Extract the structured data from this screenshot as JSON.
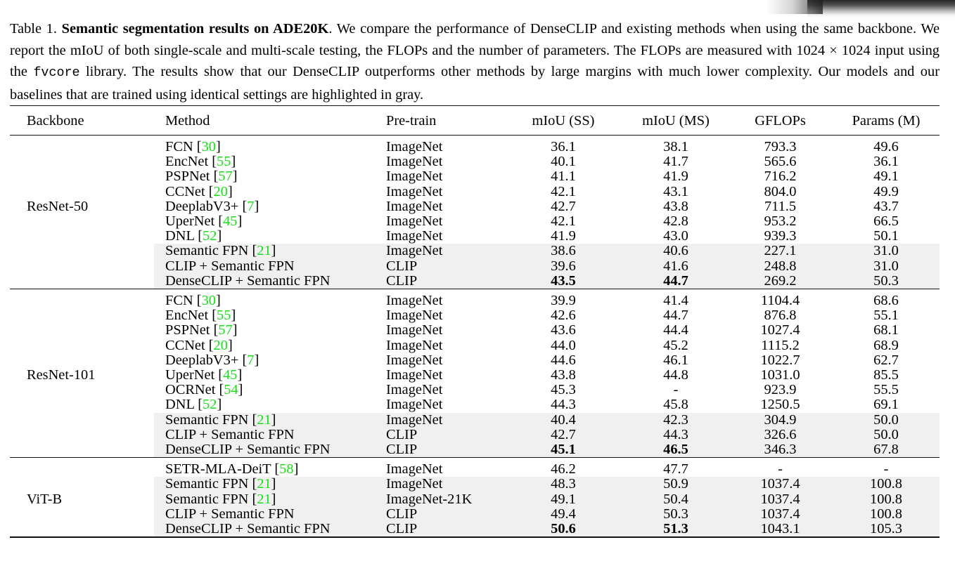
{
  "caption": {
    "label": "Table 1.",
    "title": "Semantic segmentation results on ADE20K",
    "body_1": ". We compare the performance of DenseCLIP and existing methods when using the same backbone. We report the mIoU of both single-scale and multi-scale testing, the FLOPs and the number of parameters. The FLOPs are measured with 1024 × 1024 input using the ",
    "library": "fvcore",
    "body_2": " library. The results show that our DenseCLIP outperforms other methods by large margins with much lower complexity. Our models and our baselines that are trained using identical settings are highlighted in gray."
  },
  "colors": {
    "citation_green": "#15e015",
    "highlight_gray": "#f0f0f0",
    "rule_black": "#111111"
  },
  "table": {
    "headers": [
      "Backbone",
      "Method",
      "Pre-train",
      "mIoU (SS)",
      "mIoU (MS)",
      "GFLOPs",
      "Params (M)"
    ],
    "blocks": [
      {
        "backbone": "ResNet-50",
        "rows": [
          {
            "method": "FCN",
            "cite": "30",
            "pretrain": "ImageNet",
            "ss": "36.1",
            "ms": "38.1",
            "gflops": "793.3",
            "params": "49.6",
            "highlight": false,
            "bold_ss": false,
            "bold_ms": false
          },
          {
            "method": "EncNet",
            "cite": "55",
            "pretrain": "ImageNet",
            "ss": "40.1",
            "ms": "41.7",
            "gflops": "565.6",
            "params": "36.1",
            "highlight": false,
            "bold_ss": false,
            "bold_ms": false
          },
          {
            "method": "PSPNet",
            "cite": "57",
            "pretrain": "ImageNet",
            "ss": "41.1",
            "ms": "41.9",
            "gflops": "716.2",
            "params": "49.1",
            "highlight": false,
            "bold_ss": false,
            "bold_ms": false
          },
          {
            "method": "CCNet",
            "cite": "20",
            "pretrain": "ImageNet",
            "ss": "42.1",
            "ms": "43.1",
            "gflops": "804.0",
            "params": "49.9",
            "highlight": false,
            "bold_ss": false,
            "bold_ms": false
          },
          {
            "method": "DeeplabV3+",
            "cite": "7",
            "pretrain": "ImageNet",
            "ss": "42.7",
            "ms": "43.8",
            "gflops": "711.5",
            "params": "43.7",
            "highlight": false,
            "bold_ss": false,
            "bold_ms": false
          },
          {
            "method": "UperNet",
            "cite": "45",
            "pretrain": "ImageNet",
            "ss": "42.1",
            "ms": "42.8",
            "gflops": "953.2",
            "params": "66.5",
            "highlight": false,
            "bold_ss": false,
            "bold_ms": false
          },
          {
            "method": "DNL",
            "cite": "52",
            "pretrain": "ImageNet",
            "ss": "41.9",
            "ms": "43.0",
            "gflops": "939.3",
            "params": "50.1",
            "highlight": false,
            "bold_ss": false,
            "bold_ms": false
          },
          {
            "method": "Semantic FPN",
            "cite": "21",
            "pretrain": "ImageNet",
            "ss": "38.6",
            "ms": "40.6",
            "gflops": "227.1",
            "params": "31.0",
            "highlight": true,
            "bold_ss": false,
            "bold_ms": false
          },
          {
            "method": "CLIP + Semantic FPN",
            "cite": null,
            "pretrain": "CLIP",
            "ss": "39.6",
            "ms": "41.6",
            "gflops": "248.8",
            "params": "31.0",
            "highlight": true,
            "bold_ss": false,
            "bold_ms": false
          },
          {
            "method": "DenseCLIP + Semantic FPN",
            "cite": null,
            "pretrain": "CLIP",
            "ss": "43.5",
            "ms": "44.7",
            "gflops": "269.2",
            "params": "50.3",
            "highlight": true,
            "bold_ss": true,
            "bold_ms": true
          }
        ]
      },
      {
        "backbone": "ResNet-101",
        "rows": [
          {
            "method": "FCN",
            "cite": "30",
            "pretrain": "ImageNet",
            "ss": "39.9",
            "ms": "41.4",
            "gflops": "1104.4",
            "params": "68.6",
            "highlight": false,
            "bold_ss": false,
            "bold_ms": false
          },
          {
            "method": "EncNet",
            "cite": "55",
            "pretrain": "ImageNet",
            "ss": "42.6",
            "ms": "44.7",
            "gflops": "876.8",
            "params": "55.1",
            "highlight": false,
            "bold_ss": false,
            "bold_ms": false
          },
          {
            "method": "PSPNet",
            "cite": "57",
            "pretrain": "ImageNet",
            "ss": "43.6",
            "ms": "44.4",
            "gflops": "1027.4",
            "params": "68.1",
            "highlight": false,
            "bold_ss": false,
            "bold_ms": false
          },
          {
            "method": "CCNet",
            "cite": "20",
            "pretrain": "ImageNet",
            "ss": "44.0",
            "ms": "45.2",
            "gflops": "1115.2",
            "params": "68.9",
            "highlight": false,
            "bold_ss": false,
            "bold_ms": false
          },
          {
            "method": "DeeplabV3+",
            "cite": "7",
            "pretrain": "ImageNet",
            "ss": "44.6",
            "ms": "46.1",
            "gflops": "1022.7",
            "params": "62.7",
            "highlight": false,
            "bold_ss": false,
            "bold_ms": false
          },
          {
            "method": "UperNet",
            "cite": "45",
            "pretrain": "ImageNet",
            "ss": "43.8",
            "ms": "44.8",
            "gflops": "1031.0",
            "params": "85.5",
            "highlight": false,
            "bold_ss": false,
            "bold_ms": false
          },
          {
            "method": "OCRNet",
            "cite": "54",
            "pretrain": "ImageNet",
            "ss": "45.3",
            "ms": "-",
            "gflops": "923.9",
            "params": "55.5",
            "highlight": false,
            "bold_ss": false,
            "bold_ms": false
          },
          {
            "method": "DNL",
            "cite": "52",
            "pretrain": "ImageNet",
            "ss": "44.3",
            "ms": "45.8",
            "gflops": "1250.5",
            "params": "69.1",
            "highlight": false,
            "bold_ss": false,
            "bold_ms": false
          },
          {
            "method": "Semantic FPN",
            "cite": "21",
            "pretrain": "ImageNet",
            "ss": "40.4",
            "ms": "42.3",
            "gflops": "304.9",
            "params": "50.0",
            "highlight": true,
            "bold_ss": false,
            "bold_ms": false
          },
          {
            "method": "CLIP + Semantic FPN",
            "cite": null,
            "pretrain": "CLIP",
            "ss": "42.7",
            "ms": "44.3",
            "gflops": "326.6",
            "params": "50.0",
            "highlight": true,
            "bold_ss": false,
            "bold_ms": false
          },
          {
            "method": "DenseCLIP + Semantic FPN",
            "cite": null,
            "pretrain": "CLIP",
            "ss": "45.1",
            "ms": "46.5",
            "gflops": "346.3",
            "params": "67.8",
            "highlight": true,
            "bold_ss": true,
            "bold_ms": true
          }
        ]
      },
      {
        "backbone": "ViT-B",
        "rows": [
          {
            "method": "SETR-MLA-DeiT",
            "cite": "58",
            "pretrain": "ImageNet",
            "ss": "46.2",
            "ms": "47.7",
            "gflops": "-",
            "params": "-",
            "highlight": false,
            "bold_ss": false,
            "bold_ms": false
          },
          {
            "method": "Semantic FPN",
            "cite": "21",
            "pretrain": "ImageNet",
            "ss": "48.3",
            "ms": "50.9",
            "gflops": "1037.4",
            "params": "100.8",
            "highlight": true,
            "bold_ss": false,
            "bold_ms": false
          },
          {
            "method": "Semantic FPN",
            "cite": "21",
            "pretrain": "ImageNet-21K",
            "ss": "49.1",
            "ms": "50.4",
            "gflops": "1037.4",
            "params": "100.8",
            "highlight": true,
            "bold_ss": false,
            "bold_ms": false
          },
          {
            "method": "CLIP + Semantic FPN",
            "cite": null,
            "pretrain": "CLIP",
            "ss": "49.4",
            "ms": "50.3",
            "gflops": "1037.4",
            "params": "100.8",
            "highlight": true,
            "bold_ss": false,
            "bold_ms": false
          },
          {
            "method": "DenseCLIP + Semantic FPN",
            "cite": null,
            "pretrain": "CLIP",
            "ss": "50.6",
            "ms": "51.3",
            "gflops": "1043.1",
            "params": "105.3",
            "highlight": true,
            "bold_ss": true,
            "bold_ms": true
          }
        ]
      }
    ]
  }
}
